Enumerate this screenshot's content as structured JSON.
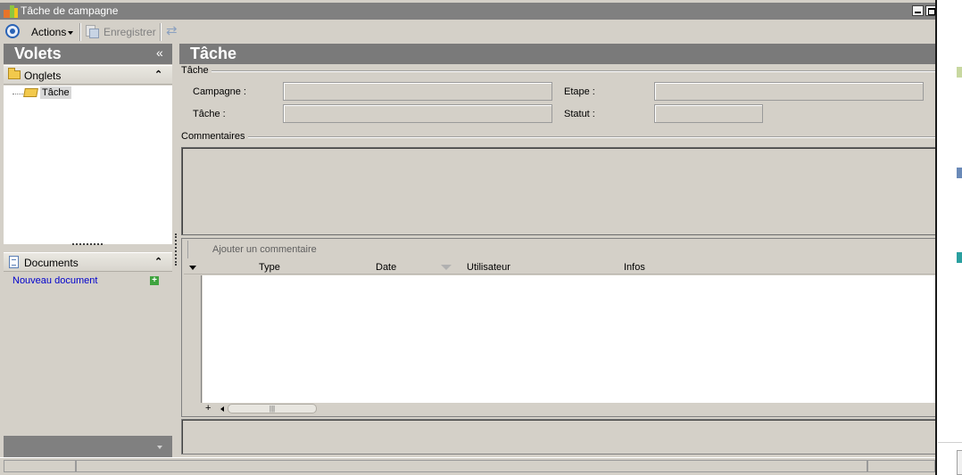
{
  "window": {
    "title": "Tâche de campagne"
  },
  "toolbar": {
    "actions_label": "Actions",
    "save_label": "Enregistrer"
  },
  "left_pane": {
    "title": "Volets",
    "collapse_glyph": "«",
    "onglets": {
      "label": "Onglets",
      "items": [
        {
          "label": "Tâche"
        }
      ]
    },
    "documents": {
      "label": "Documents",
      "new_document_label": "Nouveau document"
    }
  },
  "main": {
    "title": "Tâche",
    "group_tache": {
      "label": "Tâche",
      "fields": {
        "campagne_label": "Campagne :",
        "tache_label": "Tâche :",
        "etape_label": "Etape :",
        "statut_label": "Statut :",
        "campagne_value": "",
        "tache_value": "",
        "etape_value": "",
        "statut_value": ""
      }
    },
    "comments": {
      "label": "Commentaires",
      "add_label": "Ajouter un commentaire",
      "columns": [
        "Type",
        "Date",
        "Utilisateur",
        "Infos"
      ],
      "rows": []
    }
  },
  "colors": {
    "header_gray": "#7a7a7a",
    "window_bg": "#d4d0c8",
    "link_blue": "#0000cc"
  },
  "icons": [
    "app-icon",
    "nav-icon",
    "save-icon",
    "refresh-icon",
    "folder-icon",
    "document-icon",
    "plus-icon",
    "sort-icon"
  ]
}
